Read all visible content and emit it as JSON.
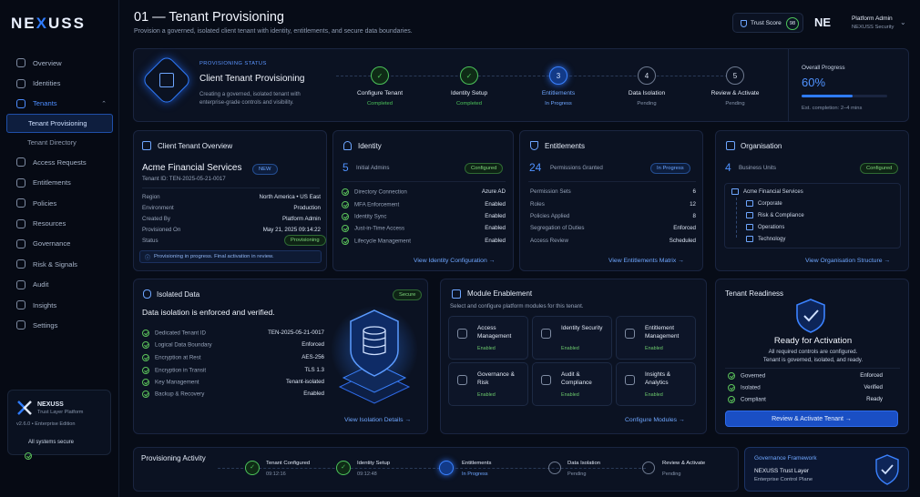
{
  "brand": {
    "logo": "NEXUSS"
  },
  "sidebar": {
    "items": [
      {
        "label": "Overview"
      },
      {
        "label": "Identities"
      },
      {
        "label": "Tenants"
      },
      {
        "label": "Access Requests"
      },
      {
        "label": "Entitlements"
      },
      {
        "label": "Policies"
      },
      {
        "label": "Resources"
      },
      {
        "label": "Governance"
      },
      {
        "label": "Risk & Signals"
      },
      {
        "label": "Audit"
      },
      {
        "label": "Insights"
      },
      {
        "label": "Settings"
      }
    ],
    "subitems": [
      {
        "label": "Tenant Provisioning"
      },
      {
        "label": "Tenant Directory"
      }
    ],
    "footer": {
      "name": "NEXUSS",
      "subtitle": "Trust Layer Platform",
      "version": "v2.6.0 • Enterprise Edition",
      "status": "All systems secure"
    }
  },
  "header": {
    "title": "01 — Tenant Provisioning",
    "subtitle": "Provision a governed, isolated client tenant with identity, entitlements, and secure data boundaries.",
    "trust_score_label": "Trust Score",
    "trust_score_value": "98",
    "user_initials": "NE",
    "user_name": "Platform Admin",
    "user_org": "NEXUSS Security"
  },
  "provisioning": {
    "status_label": "PROVISIONING STATUS",
    "title": "Client Tenant Provisioning",
    "description": "Creating a governed, isolated tenant with enterprise-grade controls and visibility.",
    "steps": [
      {
        "num": "1",
        "title": "Configure Tenant",
        "status": "Completed",
        "state": "done"
      },
      {
        "num": "2",
        "title": "Identity Setup",
        "status": "Completed",
        "state": "done"
      },
      {
        "num": "3",
        "title": "Entitlements",
        "status": "In Progress",
        "state": "progress"
      },
      {
        "num": "4",
        "title": "Data Isolation",
        "status": "Pending",
        "state": "pending"
      },
      {
        "num": "5",
        "title": "Review & Activate",
        "status": "Pending",
        "state": "pending"
      }
    ],
    "overall_label": "Overall Progress",
    "overall_value": "60%",
    "overall_fraction": 0.6,
    "completion": "Est. completion: 2–4 mins"
  },
  "overview": {
    "title": "Client Tenant Overview",
    "tenant_name": "Acme Financial Services",
    "badge": "NEW",
    "tenant_id": "Tenant ID: TEN-2025-05-21-0017",
    "rows": [
      {
        "label": "Region",
        "value": "North America • US East"
      },
      {
        "label": "Environment",
        "value": "Production"
      },
      {
        "label": "Created By",
        "value": "Platform Admin"
      },
      {
        "label": "Provisioned On",
        "value": "May 21, 2025 09:14:22"
      },
      {
        "label": "Status",
        "value": "Provisioning"
      }
    ],
    "notice": "Provisioning in progress. Final activation in review."
  },
  "identity": {
    "title": "Identity",
    "count": "5",
    "count_label": "Initial Admins",
    "badge": "Configured",
    "rows": [
      {
        "label": "Directory Connection",
        "value": "Azure AD"
      },
      {
        "label": "MFA Enforcement",
        "value": "Enabled"
      },
      {
        "label": "Identity Sync",
        "value": "Enabled"
      },
      {
        "label": "Just-in-Time Access",
        "value": "Enabled"
      },
      {
        "label": "Lifecycle Management",
        "value": "Enabled"
      }
    ],
    "link": "View Identity Configuration →"
  },
  "entitlements": {
    "title": "Entitlements",
    "count": "24",
    "count_label": "Permissions Granted",
    "badge": "In Progress",
    "rows": [
      {
        "label": "Permission Sets",
        "value": "6"
      },
      {
        "label": "Roles",
        "value": "12"
      },
      {
        "label": "Policies Applied",
        "value": "8"
      },
      {
        "label": "Segregation of Duties",
        "value": "Enforced"
      },
      {
        "label": "Access Review",
        "value": "Scheduled"
      }
    ],
    "link": "View Entitlements Matrix →"
  },
  "organisation": {
    "title": "Organisation",
    "count": "4",
    "count_label": "Business Units",
    "badge": "Configured",
    "root": "Acme Financial Services",
    "units": [
      "Corporate",
      "Risk & Compliance",
      "Operations",
      "Technology"
    ],
    "link": "View Organisation Structure →"
  },
  "isolated": {
    "title": "Isolated Data",
    "badge": "Secure",
    "headline": "Data isolation is enforced and verified.",
    "rows": [
      {
        "label": "Dedicated Tenant ID",
        "value": "TEN-2025-05-21-0017"
      },
      {
        "label": "Logical Data Boundary",
        "value": "Enforced"
      },
      {
        "label": "Encryption at Rest",
        "value": "AES-256"
      },
      {
        "label": "Encryption in Transit",
        "value": "TLS 1.3"
      },
      {
        "label": "Key Management",
        "value": "Tenant-isolated"
      },
      {
        "label": "Backup & Recovery",
        "value": "Enabled"
      }
    ],
    "link": "View Isolation Details →"
  },
  "modules": {
    "title": "Module Enablement",
    "subtitle": "Select and configure platform modules for this tenant.",
    "items": [
      {
        "name": "Access Management",
        "status": "Enabled"
      },
      {
        "name": "Identity Security",
        "status": "Enabled"
      },
      {
        "name": "Entitlement Management",
        "status": "Enabled"
      },
      {
        "name": "Governance & Risk",
        "status": "Enabled"
      },
      {
        "name": "Audit & Compliance",
        "status": "Enabled"
      },
      {
        "name": "Insights & Analytics",
        "status": "Enabled"
      }
    ],
    "link": "Configure Modules →"
  },
  "readiness": {
    "title": "Tenant Readiness",
    "headline": "Ready for Activation",
    "desc1": "All required controls are configured.",
    "desc2": "Tenant is governed, isolated, and ready.",
    "rows": [
      {
        "label": "Governed",
        "value": "Enforced"
      },
      {
        "label": "Isolated",
        "value": "Verified"
      },
      {
        "label": "Compliant",
        "value": "Ready"
      }
    ],
    "button": "Review & Activate Tenant →"
  },
  "activity": {
    "title": "Provisioning Activity",
    "events": [
      {
        "title": "Tenant Configured",
        "sub": "09:12:16",
        "state": "done"
      },
      {
        "title": "Identity Setup",
        "sub": "09:12:48",
        "state": "done"
      },
      {
        "title": "Entitlements",
        "sub": "In Progress",
        "state": "progress"
      },
      {
        "title": "Data Isolation",
        "sub": "Pending",
        "state": "pending"
      },
      {
        "title": "Review & Activate",
        "sub": "Pending",
        "state": "pending"
      }
    ]
  },
  "framework": {
    "title": "Governance Framework",
    "line1": "NEXUSS Trust Layer",
    "line2": "Enterprise Control Plane"
  },
  "colors": {
    "accent": "#2f7cff",
    "success": "#4cc35a",
    "background": "#070c17"
  }
}
